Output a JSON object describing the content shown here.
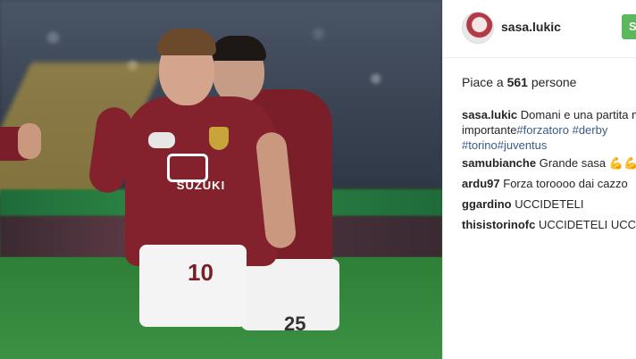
{
  "post": {
    "username": "sasa.lukic",
    "follow_label": "Se",
    "likes_prefix": "Piace a",
    "likes_count": "561",
    "likes_suffix": "persone"
  },
  "caption": {
    "username": "sasa.lukic",
    "text_line1": "Domani e una partita m",
    "text_line2_plain": "importante",
    "tag_forzatoro": "#forzatoro",
    "tag_derby": "#derby",
    "tag_torino": "#torino",
    "tag_juventus": "#juventus"
  },
  "comments": [
    {
      "username": "samubianche",
      "text": "Grande sasa",
      "emoji": "💪💪"
    },
    {
      "username": "ardu97",
      "text": "Forza toroooo dai cazzo"
    },
    {
      "username": "ggardino",
      "text": "UCCIDETELI"
    },
    {
      "username": "thisistorinofc",
      "text": "UCCIDETELI UCCID"
    }
  ],
  "photo": {
    "shirt_number_front": "10",
    "shirt_number_back": "25",
    "sponsor": "SUZUKI"
  },
  "colors": {
    "follow_button": "#5cb85c",
    "hashtag": "#3b5a86",
    "jersey": "#83212d"
  }
}
